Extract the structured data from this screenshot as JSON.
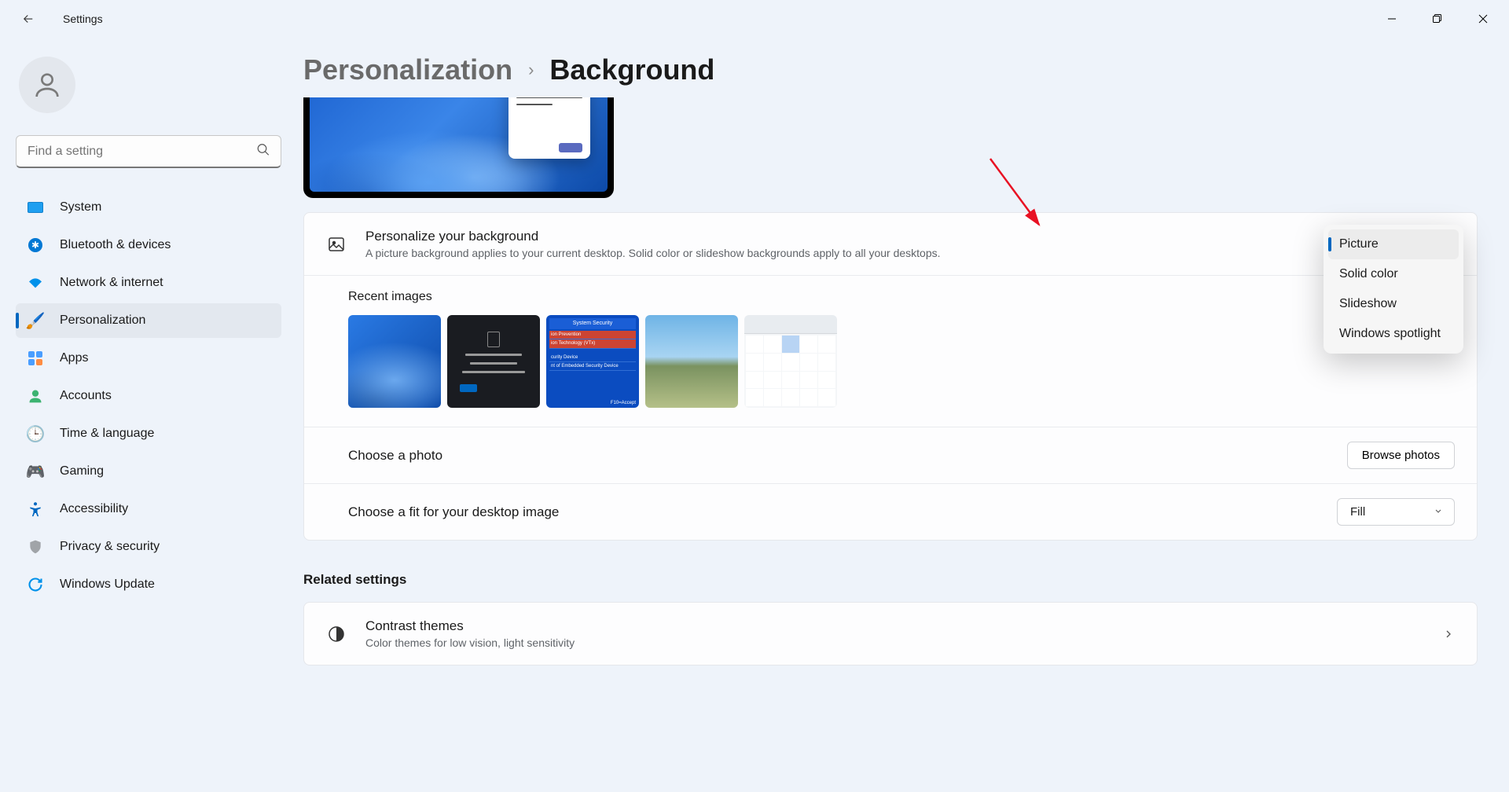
{
  "app_title": "Settings",
  "search_placeholder": "Find a setting",
  "nav": [
    {
      "label": "System"
    },
    {
      "label": "Bluetooth & devices"
    },
    {
      "label": "Network & internet"
    },
    {
      "label": "Personalization"
    },
    {
      "label": "Apps"
    },
    {
      "label": "Accounts"
    },
    {
      "label": "Time & language"
    },
    {
      "label": "Gaming"
    },
    {
      "label": "Accessibility"
    },
    {
      "label": "Privacy & security"
    },
    {
      "label": "Windows Update"
    }
  ],
  "breadcrumb": {
    "parent": "Personalization",
    "current": "Background"
  },
  "personalize": {
    "title": "Personalize your background",
    "desc": "A picture background applies to your current desktop. Solid color or slideshow backgrounds apply to all your desktops."
  },
  "recent_title": "Recent images",
  "choose_photo": {
    "label": "Choose a photo",
    "button": "Browse photos"
  },
  "choose_fit": {
    "label": "Choose a fit for your desktop image",
    "value": "Fill"
  },
  "related_title": "Related settings",
  "contrast": {
    "title": "Contrast themes",
    "desc": "Color themes for low vision, light sensitivity"
  },
  "dropdown": {
    "options": [
      "Picture",
      "Solid color",
      "Slideshow",
      "Windows spotlight"
    ],
    "selected": "Picture"
  },
  "thumb3": {
    "header": "System Security",
    "r1": "ion Prevention",
    "r2": "ion Technology (VTx)",
    "r3": "curity Device",
    "r4": "nt of Embedded Security Device",
    "footer": "F10=Accept"
  }
}
